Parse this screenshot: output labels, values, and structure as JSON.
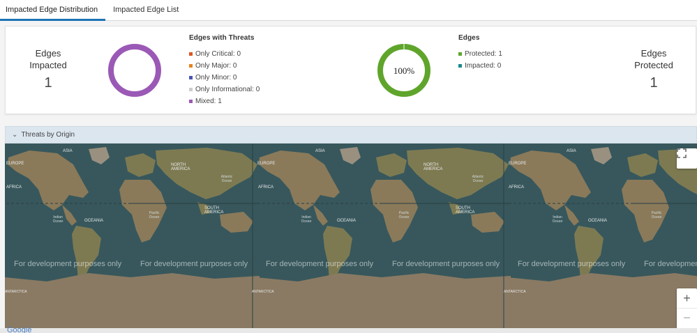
{
  "tabs": [
    {
      "label": "Impacted Edge Distribution",
      "active": true
    },
    {
      "label": "Impacted Edge List",
      "active": false
    }
  ],
  "summary": {
    "impacted": {
      "line1": "Edges",
      "line2": "Impacted",
      "value": "1"
    },
    "protected": {
      "line1": "Edges",
      "line2": "Protected",
      "value": "1"
    },
    "threats_legend": {
      "title": "Edges with Threats",
      "items": [
        {
          "label": "Only Critical: 0",
          "color": "#e0541f"
        },
        {
          "label": "Only Major: 0",
          "color": "#e9821e"
        },
        {
          "label": "Only Minor: 0",
          "color": "#4a54b3"
        },
        {
          "label": "Only Informational: 0",
          "color": "#cccccc"
        },
        {
          "label": "Mixed: 1",
          "color": "#9b59b6"
        }
      ]
    },
    "edges_legend": {
      "title": "Edges",
      "items": [
        {
          "label": "Protected: 1",
          "color": "#5fa52c"
        },
        {
          "label": "Impacted: 0",
          "color": "#1a8a8a"
        }
      ]
    },
    "protected_donut": {
      "center_label": "100%",
      "fraction": 1.0,
      "color": "#5fa52c"
    },
    "threats_donut": {
      "fraction": 1.0,
      "color": "#9b59b6"
    }
  },
  "section": {
    "title": "Threats by Origin"
  },
  "map": {
    "watermark": "For development purposes only",
    "labels": {
      "asia": "ASIA",
      "europe": "EUROPE",
      "africa": "AFRICA",
      "north_america": "NORTH AMERICA",
      "south_america": "SOUTH AMERICA",
      "oceania": "OCEANIA",
      "antarctica": "ANTARCTICA",
      "indian_ocean": "Indian Ocean",
      "pacific_ocean": "Pacific Ocean",
      "atlantic_ocean": "Atlantic Ocean"
    },
    "controls": {
      "fullscreen": "fullscreen-icon",
      "zoom_in": "+",
      "zoom_out": "−"
    },
    "attribution": "Google"
  }
}
